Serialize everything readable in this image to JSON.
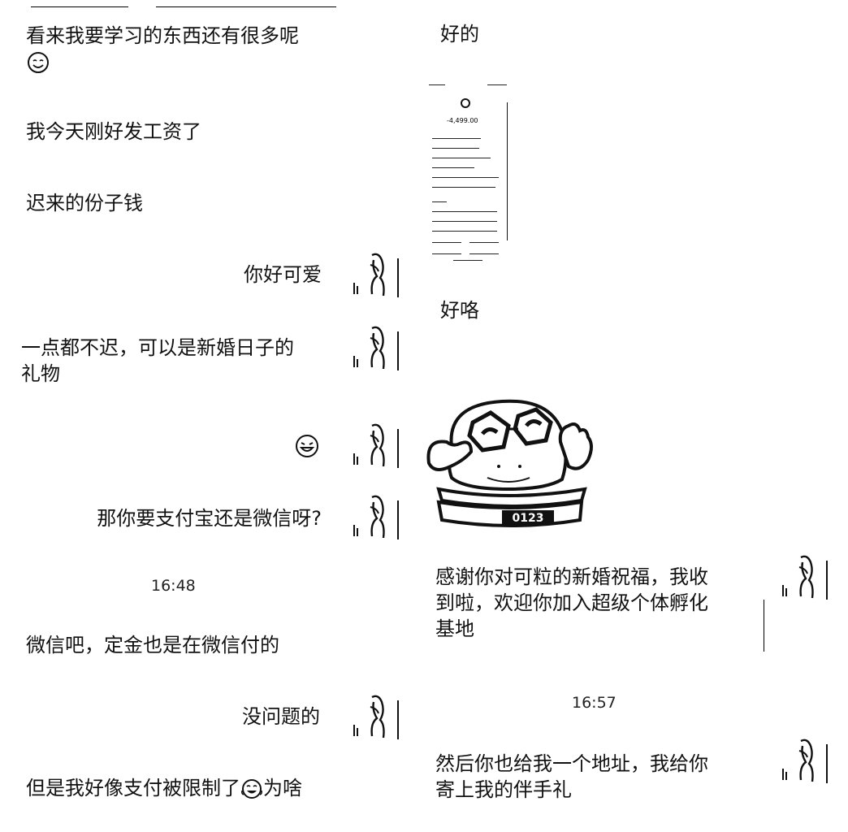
{
  "left": {
    "messages": [
      {
        "side": "left",
        "text": "看来我要学习的东西还有很多呢",
        "emoji": "smile-emoji"
      },
      {
        "side": "left",
        "text": "我今天刚好发工资了"
      },
      {
        "side": "left",
        "text": "迟来的份子钱"
      },
      {
        "side": "right",
        "text": "你好可爱"
      },
      {
        "side": "left",
        "line1": "一点都不迟，可以是新婚日子的",
        "line2": "礼物"
      },
      {
        "side": "right",
        "emoji": "laughing-emoji"
      },
      {
        "side": "right",
        "text": "那你要支付宝还是微信呀?"
      },
      {
        "side": "left",
        "text": "微信吧，定金也是在微信付的"
      },
      {
        "side": "right",
        "text": "没问题的"
      },
      {
        "side": "left",
        "text_before": "但是我好像支付被限制了",
        "text_after": "为啥",
        "emoji": "tears-of-joy-emoji"
      }
    ],
    "time_1": "16:48"
  },
  "right": {
    "messages": [
      {
        "side": "left",
        "text": "好的"
      },
      {
        "side": "left",
        "text": "好咯"
      },
      {
        "side": "right",
        "line1": "感谢你对可粒的新婚祝福，我收",
        "line2": "到啦，欢迎你加入超级个体孵化",
        "line3": "基地"
      },
      {
        "side": "right",
        "line1": "然后你也给我一个地址，我给你",
        "line2": "寄上我的伴手礼"
      }
    ],
    "time_2": "16:57",
    "payment_screenshot": {
      "amount": "-4,499.00",
      "sticker_label": "0123"
    }
  },
  "icons": {
    "avatar": "woman-line-drawing-avatar",
    "sticker": "glasses-blob-sticker"
  }
}
